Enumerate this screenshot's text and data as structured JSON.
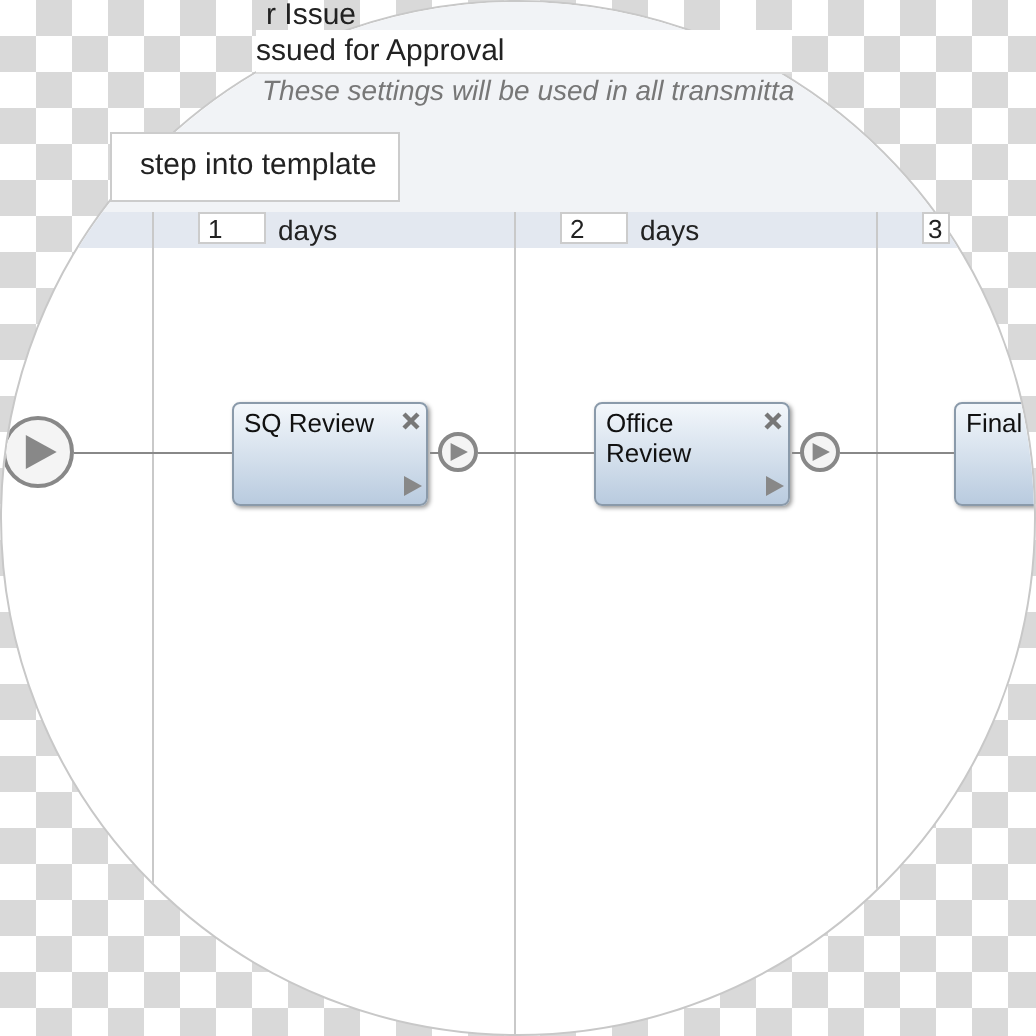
{
  "header": {
    "title_fragment": "r Issue",
    "status_field": "ssued for Approval",
    "note": "These settings will be used in all transmitta"
  },
  "template_button": "step into template",
  "columns": [
    {
      "duration": "1",
      "unit": "days"
    },
    {
      "duration": "2",
      "unit": "days"
    },
    {
      "duration": "3"
    }
  ],
  "steps": [
    {
      "label": "SQ Review",
      "kind": "full"
    },
    {
      "label": "Office Review",
      "kind": "full"
    },
    {
      "label": "Final",
      "kind": "partial"
    }
  ]
}
